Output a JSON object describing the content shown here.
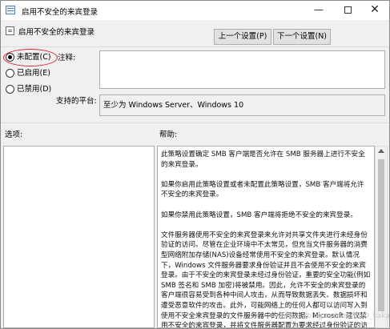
{
  "window": {
    "title": "启用不安全的来宾登录",
    "controls": {
      "minimize": "—",
      "close": "✕"
    }
  },
  "header": {
    "setting_name": "启用不安全的来宾登录",
    "prev_button": "上一个设置(P)",
    "next_button": "下一个设置(N)"
  },
  "state_options": [
    {
      "label": "未配置(C)",
      "checked": true
    },
    {
      "label": "已启用(E)",
      "checked": false
    },
    {
      "label": "已禁用(D)",
      "checked": false
    }
  ],
  "comment": {
    "label": "注释:",
    "value": ""
  },
  "supported": {
    "label": "支持的平台:",
    "value": "至少为 Windows Server、Windows 10"
  },
  "options": {
    "label": "选项:"
  },
  "help": {
    "label": "帮助:",
    "paragraphs": [
      "此策略设置确定 SMB 客户端是否允许在 SMB 服务器上进行不安全的来宾登录。",
      "如果你启用此策略设置或者未配置此策略设置，SMB 客户端将允许不安全的来宾登录。",
      "如果你禁用此策略设置，SMB 客户端将拒绝不安全的来宾登录。",
      "文件服务器使用不安全的来宾登录来允许对共享文件夹进行未经身份验证的访问。尽管在企业环境中不太常见，但充当文件服务器的消费型网络附加存储(NAS)设备经常使用不安全的来宾登录。默认情况下，Windows 文件服务器要求身份验证并且不会使用不安全的来宾登录。由于不安全的来宾登录未经过身份验证，重要的安全功能(例如 SMB 签名和 SMB 加密)将被禁用。因此，允许不安全的来宾登录的客户端很容易受到各种中间人攻击，从而导致数据丢失、数据损坏和遭受恶意软件的攻击。此外，可能网络上的任何人都可以访问写入到使用不安全来宾登录的文件服务器中的任何数据。Microsoft 建议禁用不安全的来宾登录，并将文件服务器配置为要求经过身份验证的访问。"
    ]
  },
  "watermark": "https://blog.csdn.net/NO_kakapo",
  "colors": {
    "highlight_ring": "#d9232f"
  }
}
